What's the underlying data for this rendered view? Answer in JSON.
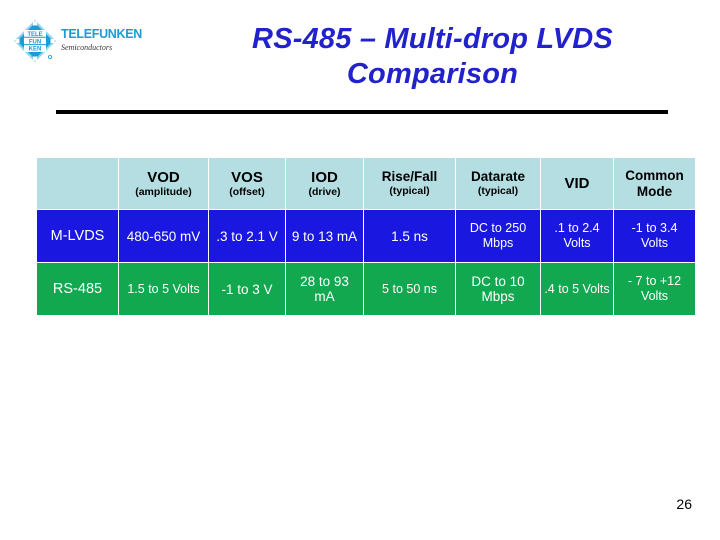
{
  "slide": {
    "title_line1": "RS-485 – Multi-drop LVDS",
    "title_line2": "Comparison",
    "page_number": "26",
    "colors": {
      "title": "#2222cc",
      "header_bg": "#b5dee2",
      "mlvds_bg": "#1a18e0",
      "rs485_bg": "#11a850",
      "rule": "#000000",
      "logo_blue": "#1a9cd8"
    }
  },
  "logo": {
    "icon": "telefunken-diamond-logo",
    "name": "TELEFUNKEN",
    "tagline": "Semiconductors",
    "mark_letters": [
      "TELE",
      "FUN",
      "KEN"
    ]
  },
  "table": {
    "headers": [
      {
        "main": "",
        "sub": ""
      },
      {
        "main": "VOD",
        "sub": "(amplitude)"
      },
      {
        "main": "VOS",
        "sub": "(offset)"
      },
      {
        "main": "IOD",
        "sub": "(drive)"
      },
      {
        "main": "Rise/Fall",
        "sub": "(typical)"
      },
      {
        "main": "Datarate",
        "sub": "(typical)"
      },
      {
        "main": "VID",
        "sub": ""
      },
      {
        "main": "Common Mode",
        "sub": ""
      }
    ],
    "rows": [
      {
        "label": "M-LVDS",
        "vod": "480-650 mV",
        "vos": ".3 to 2.1 V",
        "iod": "9 to 13 mA",
        "rise_fall": "1.5 ns",
        "datarate": "DC to 250 Mbps",
        "vid": ".1 to 2.4 Volts",
        "common_mode": "-1 to 3.4 Volts"
      },
      {
        "label": "RS-485",
        "vod": "1.5 to 5 Volts",
        "vos": "-1 to 3 V",
        "iod": "28 to 93 mA",
        "rise_fall": "5 to 50 ns",
        "datarate": "DC to 10 Mbps",
        "vid": ".4 to 5 Volts",
        "common_mode": "- 7 to +12 Volts"
      }
    ]
  }
}
